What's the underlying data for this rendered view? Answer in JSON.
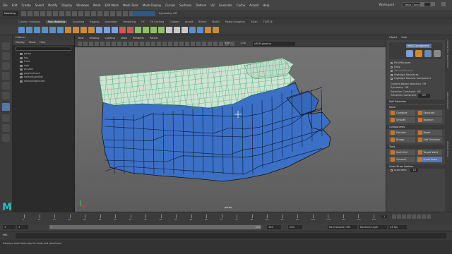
{
  "menubar": {
    "items": [
      "File",
      "Edit",
      "Create",
      "Select",
      "Modify",
      "Display",
      "Windows",
      "Mesh",
      "Edit Mesh",
      "Mesh Tools",
      "Mesh Display",
      "Curves",
      "Surfaces",
      "Deform",
      "UV",
      "Generate",
      "Cache",
      "Arnold",
      "Help"
    ],
    "workspace_label": "Workspace :",
    "workspace_value": "Maya Classic*"
  },
  "statusline": {
    "mode": "Modeling",
    "symmetry": "Symmetry: Off"
  },
  "shelf": {
    "tabs": [
      "Curves / Surfaces",
      "Poly Modeling",
      "Sculpting",
      "Rigging",
      "Animation",
      "Rendering",
      "FX",
      "FX Caching",
      "Custom",
      "Arnold",
      "Bifrost",
      "MASH",
      "Motion Graphics",
      "XGen",
      "TURTLE"
    ],
    "active_tab": "Poly Modeling"
  },
  "outliner": {
    "title": "Outliner",
    "menu": [
      "Display",
      "Show",
      "Help"
    ],
    "items": [
      "persp",
      "top",
      "front",
      "side",
      "pCube1",
      "polySurface1",
      "defaultLightSet",
      "defaultObjectSet"
    ]
  },
  "viewport": {
    "menu": [
      "View",
      "Shading",
      "Lighting",
      "Show",
      "Renderer",
      "Panels"
    ],
    "exposure": "0.00",
    "gamma": "1.00",
    "color_space": "sRGB gamma",
    "camera": "persp"
  },
  "modeling_toolkit": {
    "tabs": [
      "Object",
      "Help"
    ],
    "title": "Multi-Component",
    "options": [
      "Pick/Marquee",
      "Drag",
      "Tweak/Marquee",
      "Highlight Backfaces",
      "Highlight Nearest Component"
    ],
    "camera_based": "Camera Based Selection",
    "camera_based_value": "Off",
    "symmetry": "Symmetry",
    "symmetry_value": "Off",
    "sel_constraint": "Selection Constraint",
    "sel_constraint_value": "Off",
    "transform_constraint": "Transform Constraint",
    "transform_constraint_value": "Off",
    "soft_selection": "Soft Selection",
    "mesh_section": "Mesh",
    "mesh_buttons": [
      [
        "Combine",
        "Separate"
      ],
      [
        "Smooth",
        "Boolean"
      ]
    ],
    "components_section": "Components",
    "component_buttons": [
      [
        "Extrude",
        "Bevel"
      ],
      [
        "Bridge",
        "Add Divisions"
      ]
    ],
    "tools_section": "Tools",
    "tool_buttons": [
      [
        "Multi-Cut",
        "Target Weld"
      ],
      [
        "Connect",
        "Quad Draw"
      ]
    ],
    "quad_draw_options": "Quad Draw Options",
    "auto_weld": "Auto weld",
    "auto_weld_value": "10"
  },
  "sidetabs": [
    "Channel Box / Layer Editor",
    "Modeling Toolkit",
    "Attribute Editor"
  ],
  "timeslider": {
    "ticks": [
      "5",
      "10",
      "15",
      "20",
      "25",
      "30",
      "35",
      "40",
      "45",
      "50",
      "55",
      "60",
      "65",
      "70",
      "75",
      "80",
      "85",
      "90",
      "95",
      "100",
      "105",
      "110",
      "115",
      "120"
    ],
    "current_frame": "1"
  },
  "rangebar": {
    "start": "1",
    "start2": "1",
    "range_start": "1",
    "range_end": "120",
    "end": "120",
    "end2": "200",
    "char_set": "No Character Set",
    "anim_layer": "No Anim Layer",
    "fps": "24 fps"
  },
  "cmdline": {
    "label": "MEL"
  },
  "helpline": {
    "text": "Displays short help tips for tools and selections"
  },
  "logo": "M",
  "colors": {
    "mesh_blue": "#3a6fc4",
    "mesh_top": "#cfe0d4",
    "wire_green": "#4fc07a",
    "accent_blue": "#5a77a8",
    "maya_teal": "#1fc0c8"
  }
}
